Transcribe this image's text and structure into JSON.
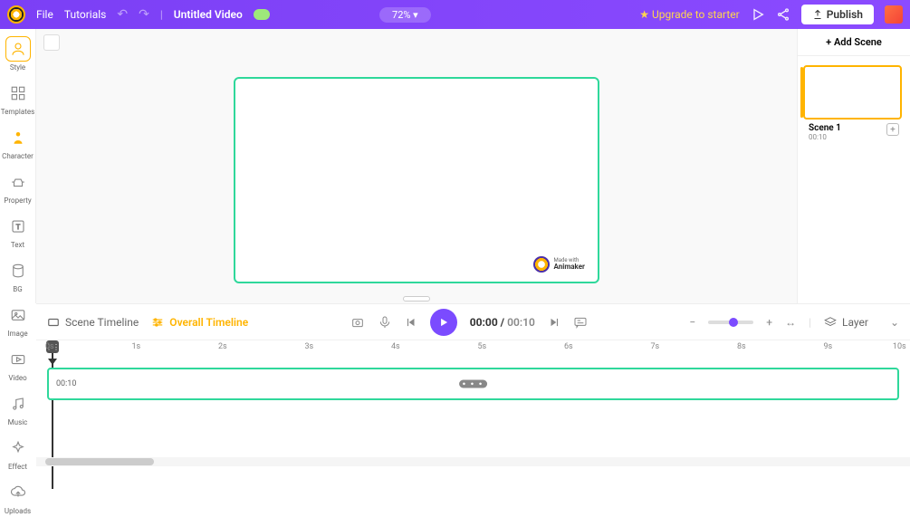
{
  "topbar": {
    "menu_file": "File",
    "menu_tutorials": "Tutorials",
    "title": "Untitled Video",
    "zoom": "72%",
    "upgrade": "Upgrade to starter",
    "publish": "Publish"
  },
  "sidebar": {
    "items": [
      {
        "label": "Style"
      },
      {
        "label": "Templates"
      },
      {
        "label": "Character"
      },
      {
        "label": "Property"
      },
      {
        "label": "Text"
      },
      {
        "label": "BG"
      },
      {
        "label": "Image"
      },
      {
        "label": "Video"
      },
      {
        "label": "Music"
      },
      {
        "label": "Effect"
      },
      {
        "label": "Uploads"
      }
    ]
  },
  "canvas": {
    "watermark_small": "Made with",
    "watermark_brand": "Animaker"
  },
  "scenes": {
    "add_label": "+ Add Scene",
    "list": [
      {
        "name": "Scene 1",
        "duration": "00:10"
      }
    ]
  },
  "timeline": {
    "scene_tab": "Scene Timeline",
    "overall_tab": "Overall Timeline",
    "current": "00:00",
    "total": "00:10",
    "layer_label": "Layer",
    "ruler": [
      "0s",
      "1s",
      "2s",
      "3s",
      "4s",
      "5s",
      "6s",
      "7s",
      "8s",
      "9s",
      "10s"
    ],
    "clip_duration": "00:10"
  }
}
